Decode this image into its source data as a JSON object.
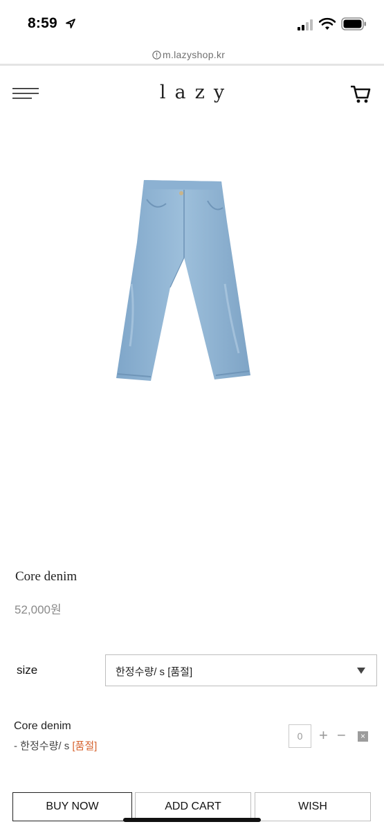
{
  "status_bar": {
    "time": "8:59",
    "icons": [
      "location-arrow-icon",
      "signal-icon",
      "wifi-icon",
      "battery-icon"
    ]
  },
  "browser": {
    "url": "m.lazyshop.kr",
    "url_icon": "info-icon"
  },
  "header": {
    "logo": "lazy",
    "menu_icon": "hamburger-menu-icon",
    "cart_icon": "shopping-cart-icon"
  },
  "product": {
    "name": "Core denim",
    "price": "52,000원",
    "image_description": "light blue denim jeans"
  },
  "options": {
    "size_label": "size",
    "size_selected": "한정수량/ s [품절]"
  },
  "selected_item": {
    "name": "Core denim",
    "option_prefix": "- 한정수량/ s ",
    "option_soldout": "[품절]",
    "quantity": "0",
    "plus": "+",
    "minus": "−",
    "remove": "×"
  },
  "actions": {
    "buy_now": "BUY NOW",
    "add_cart": "ADD CART",
    "wish": "WISH"
  },
  "colors": {
    "soldout": "#d6622e",
    "denim": "#8fb3d2"
  }
}
